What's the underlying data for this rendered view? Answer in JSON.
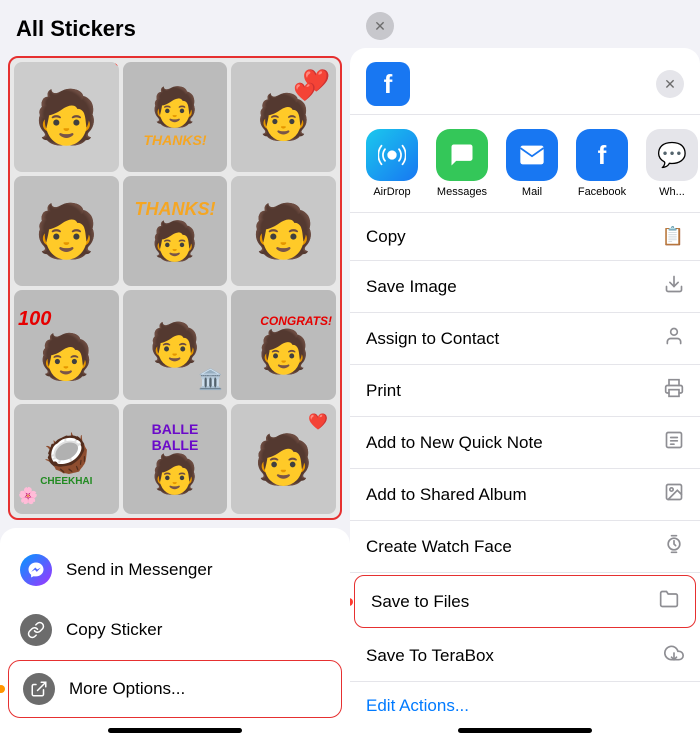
{
  "left": {
    "title": "All Stickers",
    "stickers": [
      {
        "emoji": "🧑",
        "overlay": null
      },
      {
        "emoji": "🧑",
        "overlay": "THANKS!"
      },
      {
        "emoji": "🧑",
        "overlay": null
      },
      {
        "emoji": "🧑",
        "overlay": null
      },
      {
        "emoji": "🧑",
        "overlay": "100"
      },
      {
        "emoji": "🧑",
        "overlay": null
      },
      {
        "emoji": "🧑",
        "overlay": "CONGRATS!"
      },
      {
        "emoji": "🥥",
        "overlay": "CHEEKHAI"
      },
      {
        "emoji": "🧑",
        "overlay": "BALLE BALLE"
      },
      {
        "emoji": "🧑",
        "overlay": null
      }
    ],
    "actions": [
      {
        "id": "messenger",
        "label": "Send in Messenger",
        "icon": "messenger"
      },
      {
        "id": "copy-sticker",
        "label": "Copy Sticker",
        "icon": "link"
      },
      {
        "id": "more-options",
        "label": "More Options...",
        "icon": "share",
        "highlighted": true
      }
    ],
    "home_indicator": ""
  },
  "right": {
    "close_top": "✕",
    "fb_logo": "f",
    "close_sheet": "✕",
    "app_icons": [
      {
        "id": "airdrop",
        "label": "AirDrop",
        "icon_type": "airdrop"
      },
      {
        "id": "messages",
        "label": "Messages",
        "icon_type": "messages"
      },
      {
        "id": "mail",
        "label": "Mail",
        "icon_type": "mail"
      },
      {
        "id": "facebook",
        "label": "Facebook",
        "icon_type": "facebook"
      },
      {
        "id": "whatsapp",
        "label": "Wh...",
        "icon_type": "more"
      }
    ],
    "menu_items": [
      {
        "id": "copy",
        "label": "Copy",
        "icon": "📋",
        "highlighted": false
      },
      {
        "id": "save-image",
        "label": "Save Image",
        "icon": "⬇",
        "highlighted": false
      },
      {
        "id": "assign-contact",
        "label": "Assign to Contact",
        "icon": "👤",
        "highlighted": false
      },
      {
        "id": "print",
        "label": "Print",
        "icon": "🖨",
        "highlighted": false
      },
      {
        "id": "add-quick-note",
        "label": "Add to New Quick Note",
        "icon": "📝",
        "highlighted": false
      },
      {
        "id": "add-shared-album",
        "label": "Add to Shared Album",
        "icon": "🖼",
        "highlighted": false
      },
      {
        "id": "create-watch-face",
        "label": "Create Watch Face",
        "icon": "⌚",
        "highlighted": false
      },
      {
        "id": "save-to-files",
        "label": "Save to Files",
        "icon": "📁",
        "highlighted": true
      },
      {
        "id": "save-terabox",
        "label": "Save To TeraBox",
        "icon": "☁",
        "highlighted": false
      }
    ],
    "edit_actions": "Edit Actions...",
    "home_indicator": ""
  }
}
